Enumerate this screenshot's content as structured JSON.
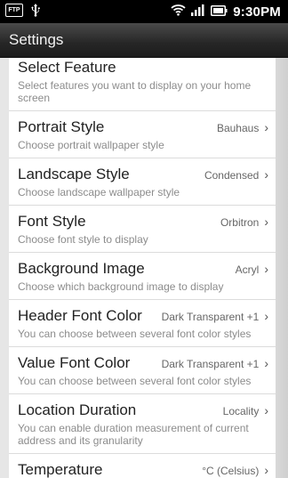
{
  "status_bar": {
    "ftp_label": "FTP",
    "time": "9:30PM"
  },
  "header": {
    "title": "Settings"
  },
  "settings": [
    {
      "title": "Select Feature",
      "value": "",
      "subtitle": "Select features you want to display on your home screen"
    },
    {
      "title": "Portrait Style",
      "value": "Bauhaus",
      "subtitle": "Choose portrait wallpaper style"
    },
    {
      "title": "Landscape Style",
      "value": "Condensed",
      "subtitle": "Choose landscape wallpaper style"
    },
    {
      "title": "Font Style",
      "value": "Orbitron",
      "subtitle": "Choose font style to display"
    },
    {
      "title": "Background Image",
      "value": "Acryl",
      "subtitle": "Choose which background image to display"
    },
    {
      "title": "Header Font Color",
      "value": "Dark Transparent +1",
      "subtitle": "You can choose between several font color styles"
    },
    {
      "title": "Value Font Color",
      "value": "Dark Transparent +1",
      "subtitle": "You can choose between several font color styles"
    },
    {
      "title": "Location Duration",
      "value": "Locality",
      "subtitle": "You can enable duration measurement of current address and its granularity"
    },
    {
      "title": "Temperature",
      "value": "°C (Celsius)",
      "subtitle": ""
    }
  ]
}
